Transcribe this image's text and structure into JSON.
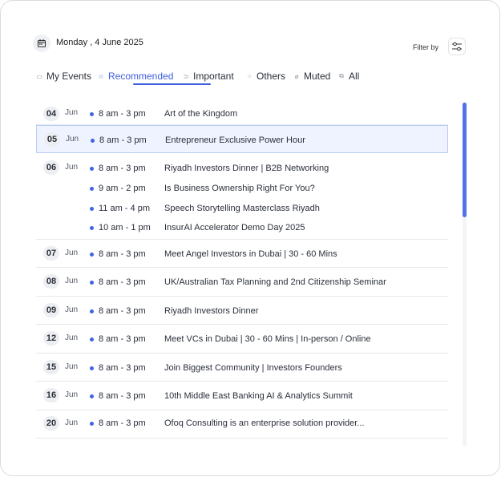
{
  "header": {
    "date": "Monday , 4 June 2025",
    "filter_label": "Filter by"
  },
  "tabs": [
    {
      "label": "My Events",
      "icon": "calendar-icon",
      "active": false
    },
    {
      "label": "Recommended",
      "icon": "star-icon",
      "active": true
    },
    {
      "label": "Important",
      "icon": "tag-icon",
      "active": false
    },
    {
      "label": "Others",
      "icon": "grid-icon",
      "active": false
    },
    {
      "label": "Muted",
      "icon": "mute-icon",
      "active": false
    },
    {
      "label": "All",
      "icon": "stack-icon",
      "active": false
    }
  ],
  "days": [
    {
      "day": "04",
      "month": "Jun",
      "events": [
        {
          "time": "8 am - 3 pm",
          "title": "Art of the Kingdom"
        }
      ]
    },
    {
      "day": "05",
      "month": "Jun",
      "selected": true,
      "events": [
        {
          "time": "8 am - 3 pm",
          "title": "Entrepreneur Exclusive Power Hour"
        }
      ]
    },
    {
      "day": "06",
      "month": "Jun",
      "events": [
        {
          "time": "8 am - 3 pm",
          "title": "Riyadh Investors Dinner | B2B Networking"
        },
        {
          "time": "9 am - 2 pm",
          "title": "Is Business Ownership Right For You?"
        },
        {
          "time": "11 am - 4 pm",
          "title": "Speech Storytelling Masterclass Riyadh"
        },
        {
          "time": "10 am - 1 pm",
          "title": "InsurAI Accelerator Demo Day 2025"
        }
      ]
    },
    {
      "day": "07",
      "month": "Jun",
      "events": [
        {
          "time": "8 am - 3 pm",
          "title": "Meet Angel Investors in Dubai | 30 - 60 Mins"
        }
      ]
    },
    {
      "day": "08",
      "month": "Jun",
      "events": [
        {
          "time": "8 am - 3 pm",
          "title": "UK/Australian Tax Planning and 2nd Citizenship Seminar"
        }
      ]
    },
    {
      "day": "09",
      "month": "Jun",
      "events": [
        {
          "time": "8 am - 3 pm",
          "title": "Riyadh Investors Dinner"
        }
      ]
    },
    {
      "day": "12",
      "month": "Jun",
      "events": [
        {
          "time": "8 am - 3 pm",
          "title": "Meet VCs in Dubai | 30 - 60 Mins | In-person / Online"
        }
      ]
    },
    {
      "day": "15",
      "month": "Jun",
      "events": [
        {
          "time": "8 am - 3 pm",
          "title": "Join Biggest Community | Investors Founders"
        }
      ]
    },
    {
      "day": "16",
      "month": "Jun",
      "events": [
        {
          "time": "8 am - 3 pm",
          "title": "10th Middle East Banking AI & Analytics Summit"
        }
      ]
    },
    {
      "day": "20",
      "month": "Jun",
      "events": [
        {
          "time": "8 am - 3 pm",
          "title": "Ofoq Consulting is an enterprise solution provider..."
        }
      ]
    }
  ],
  "colors": {
    "accent": "#3f5fe0",
    "dot": "#3f64e6",
    "selected_bg": "#eef3ff"
  },
  "scroll_position": 0
}
